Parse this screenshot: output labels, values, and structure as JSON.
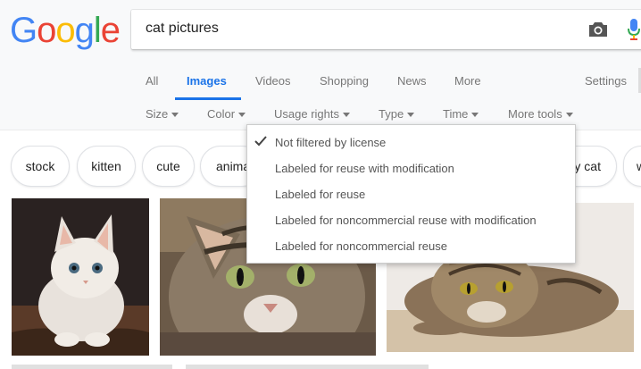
{
  "logo": {
    "letters": [
      "G",
      "o",
      "o",
      "g",
      "l",
      "e"
    ],
    "colors": [
      "#4285f4",
      "#ea4335",
      "#fbbc05",
      "#4285f4",
      "#34a853",
      "#ea4335"
    ]
  },
  "search": {
    "query": "cat pictures"
  },
  "tabs": [
    {
      "label": "All"
    },
    {
      "label": "Images",
      "active": true
    },
    {
      "label": "Videos"
    },
    {
      "label": "Shopping"
    },
    {
      "label": "News"
    },
    {
      "label": "More"
    }
  ],
  "settings_label": "Settings",
  "tools": [
    {
      "label": "Size"
    },
    {
      "label": "Color"
    },
    {
      "label": "Usage rights"
    },
    {
      "label": "Type"
    },
    {
      "label": "Time"
    },
    {
      "label": "More tools"
    }
  ],
  "chips": [
    "stock",
    "kitten",
    "cute",
    "anima",
    "y cat",
    "w"
  ],
  "usage_rights_menu": {
    "items": [
      {
        "label": "Not filtered by license",
        "selected": true
      },
      {
        "label": "Labeled for reuse with modification"
      },
      {
        "label": "Labeled for reuse"
      },
      {
        "label": "Labeled for noncommercial reuse with modification"
      },
      {
        "label": "Labeled for noncommercial reuse"
      }
    ]
  },
  "accent_color": "#1a73e8"
}
